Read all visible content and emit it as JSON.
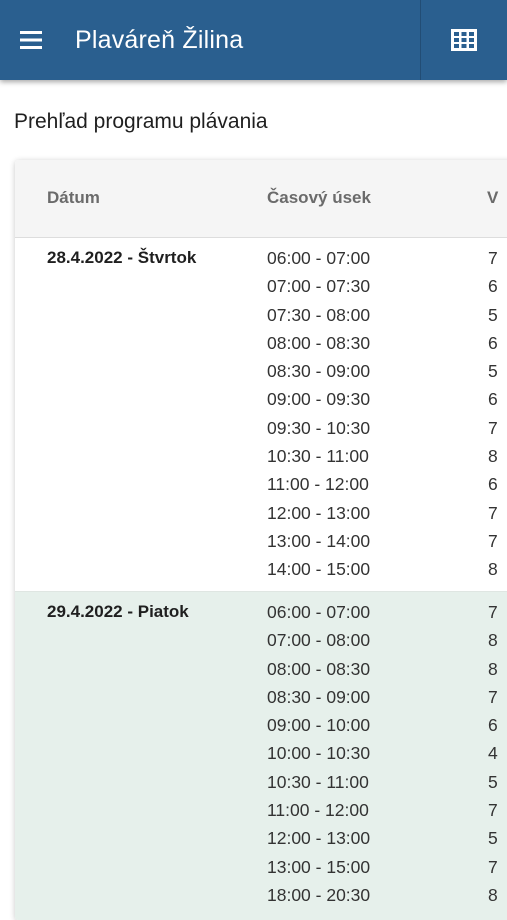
{
  "app": {
    "title": "Plaváreň Žilina",
    "menu_icon": "menu-icon",
    "grid_icon": "grid-icon",
    "bar_color": "#2a5f8f"
  },
  "page": {
    "heading": "Prehľad programu plávania"
  },
  "table": {
    "headers": {
      "date": "Dátum",
      "time": "Časový úsek",
      "lanes": "V"
    },
    "days": [
      {
        "date": "28.4.2022 - Štvrtok",
        "slots": [
          {
            "time": "06:00 - 07:00",
            "value": "7"
          },
          {
            "time": "07:00 - 07:30",
            "value": "6"
          },
          {
            "time": "07:30 - 08:00",
            "value": "5"
          },
          {
            "time": "08:00 - 08:30",
            "value": "6"
          },
          {
            "time": "08:30 - 09:00",
            "value": "5"
          },
          {
            "time": "09:00 - 09:30",
            "value": "6"
          },
          {
            "time": "09:30 - 10:30",
            "value": "7"
          },
          {
            "time": "10:30 - 11:00",
            "value": "8"
          },
          {
            "time": "11:00 - 12:00",
            "value": "6"
          },
          {
            "time": "12:00 - 13:00",
            "value": "7"
          },
          {
            "time": "13:00 - 14:00",
            "value": "7"
          },
          {
            "time": "14:00 - 15:00",
            "value": "8"
          }
        ]
      },
      {
        "date": "29.4.2022 - Piatok",
        "slots": [
          {
            "time": "06:00 - 07:00",
            "value": "7"
          },
          {
            "time": "07:00 - 08:00",
            "value": "8"
          },
          {
            "time": "08:00 - 08:30",
            "value": "8"
          },
          {
            "time": "08:30 - 09:00",
            "value": "7"
          },
          {
            "time": "09:00 - 10:00",
            "value": "6"
          },
          {
            "time": "10:00 - 10:30",
            "value": "4"
          },
          {
            "time": "10:30 - 11:00",
            "value": "5"
          },
          {
            "time": "11:00 - 12:00",
            "value": "7"
          },
          {
            "time": "12:00 - 13:00",
            "value": "5"
          },
          {
            "time": "13:00 - 15:00",
            "value": "7"
          },
          {
            "time": "18:00 - 20:30",
            "value": "8"
          }
        ]
      }
    ]
  }
}
